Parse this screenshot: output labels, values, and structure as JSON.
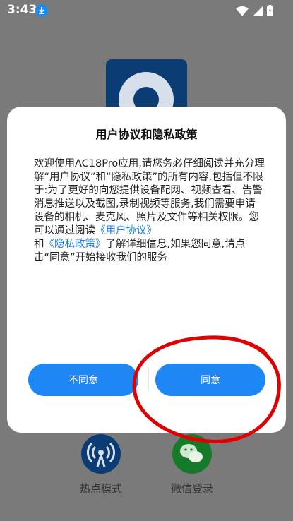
{
  "status_bar": {
    "time": "3:43",
    "icons": [
      "download-icon",
      "wifi-icon",
      "signal-icon",
      "battery-icon"
    ]
  },
  "background": {
    "bottom_items": [
      {
        "label": "热点模式",
        "icon": "hotspot-icon"
      },
      {
        "label": "微信登录",
        "icon": "wechat-icon"
      }
    ]
  },
  "dialog": {
    "title": "用户协议和隐私政策",
    "body_part1": "欢迎使用AC18Pro应用,请您务必仔细阅读并充分理解“用户协议”和“隐私政策”的所有内容,包括但不限于:为了更好的向您提供设备配网、视频查看、告警消息推送以及截图,录制视频等服务,我们需要申请设备的相机、麦克风、照片及文件等相关权限。您可以通过阅读",
    "link_user_agreement": "《用户协议》",
    "body_part2": "和",
    "link_privacy_policy": "《隐私政策》",
    "body_part3": "了解详细信息,如果您同意,请点击“同意”开始接收我们的服务",
    "disagree_label": "不同意",
    "agree_label": "同意"
  },
  "colors": {
    "accent": "#1f86f5",
    "link": "#1c7fe3",
    "annotation": "#e00000"
  }
}
